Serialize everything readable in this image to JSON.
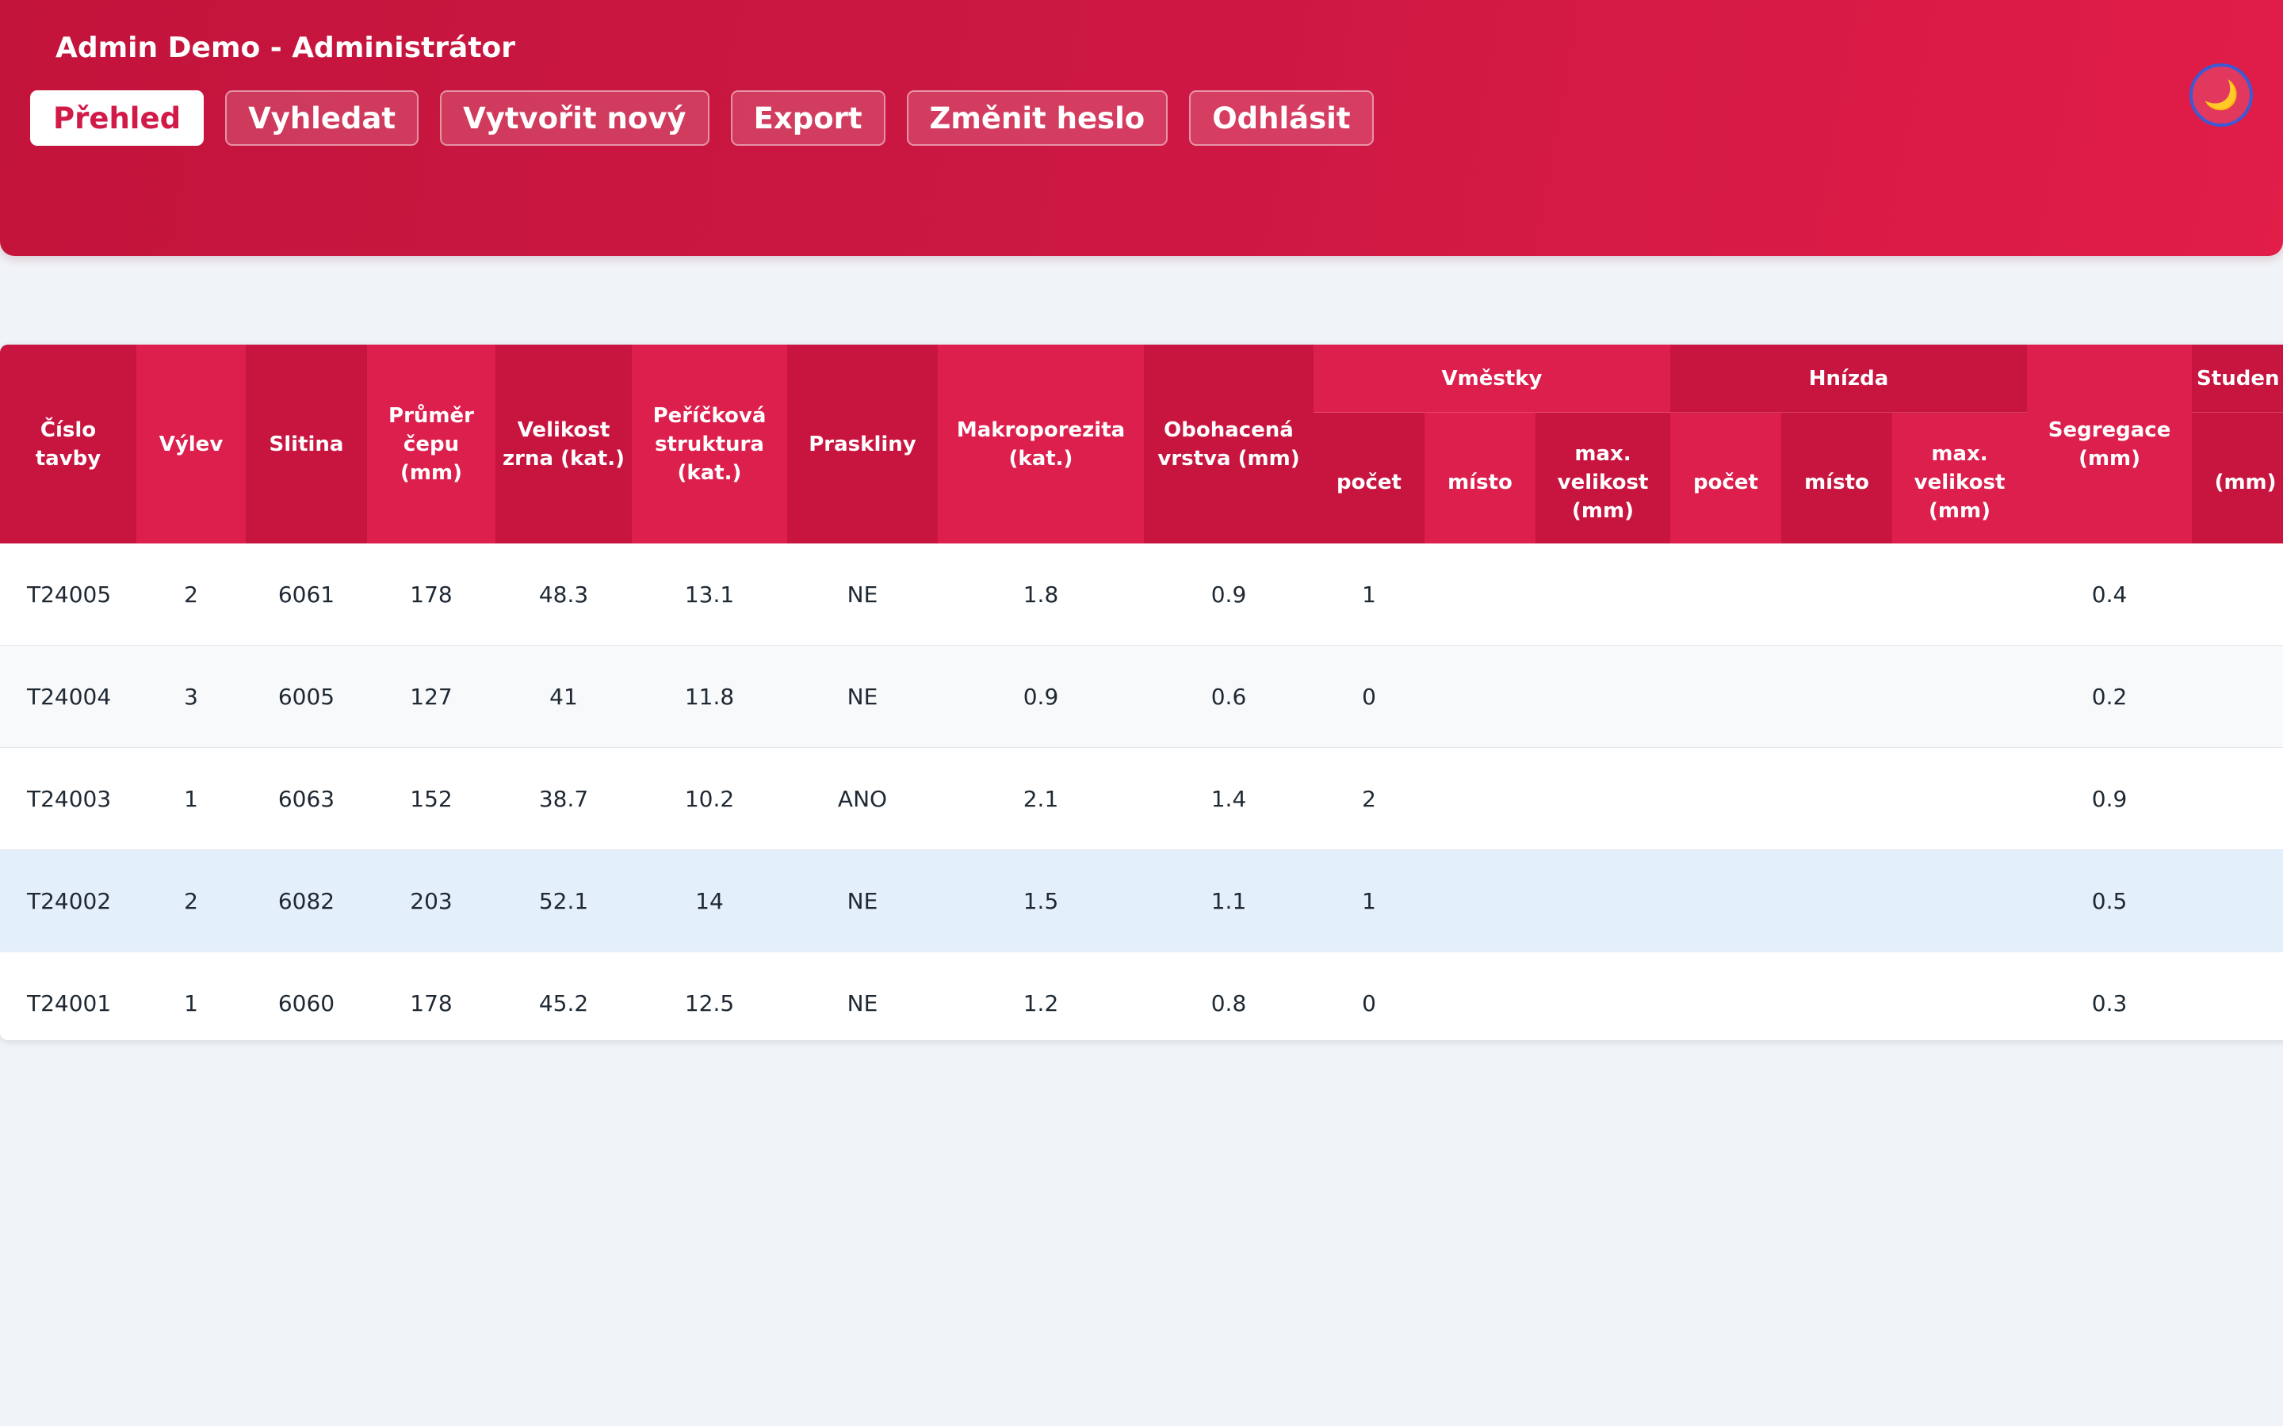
{
  "header": {
    "user_title": "Admin Demo - Administrátor",
    "nav": [
      {
        "label": "Přehled",
        "active": true
      },
      {
        "label": "Vyhledat",
        "active": false
      },
      {
        "label": "Vytvořit nový",
        "active": false
      },
      {
        "label": "Export",
        "active": false
      },
      {
        "label": "Změnit heslo",
        "active": false
      },
      {
        "label": "Odhlásit",
        "active": false
      }
    ],
    "theme_toggle_icon": "🌙"
  },
  "colors": {
    "accent": "#d11a47",
    "header_gradient_start": "#c3143c",
    "header_gradient_end": "#e11d48",
    "row_highlight": "#e3f0fb"
  },
  "table": {
    "columns": {
      "cislo_tavby": "Číslo tavby",
      "vylev": "Výlev",
      "slitina": "Slitina",
      "prumer_cepu": "Průměr čepu (mm)",
      "velikost_zrna": "Velikost zrna (kat.)",
      "perickova_struktura": "Peříčková struktura (kat.)",
      "praskliny": "Praskliny",
      "makroporezita": "Makroporezita (kat.)",
      "obohacena_vrstva": "Obohacená vrstva (mm)",
      "vmestky": "Vměstky",
      "hnizda": "Hnízda",
      "segregace": "Segregace (mm)",
      "studene": "Studen",
      "pocet": "počet",
      "misto": "místo",
      "max_velikost": "max. velikost (mm)",
      "mm": "(mm)"
    },
    "rows": [
      {
        "tavba": "T24005",
        "vylev": "2",
        "slitina": "6061",
        "prumer": "178",
        "zrno": "48.3",
        "perickova": "13.1",
        "praskliny": "NE",
        "makro": "1.8",
        "obohacena": "0.9",
        "vm_pocet": "1",
        "vm_misto": "",
        "vm_max": "",
        "hn_pocet": "",
        "hn_misto": "",
        "hn_max": "",
        "segregace": "0.4",
        "studene": ""
      },
      {
        "tavba": "T24004",
        "vylev": "3",
        "slitina": "6005",
        "prumer": "127",
        "zrno": "41",
        "perickova": "11.8",
        "praskliny": "NE",
        "makro": "0.9",
        "obohacena": "0.6",
        "vm_pocet": "0",
        "vm_misto": "",
        "vm_max": "",
        "hn_pocet": "",
        "hn_misto": "",
        "hn_max": "",
        "segregace": "0.2",
        "studene": ""
      },
      {
        "tavba": "T24003",
        "vylev": "1",
        "slitina": "6063",
        "prumer": "152",
        "zrno": "38.7",
        "perickova": "10.2",
        "praskliny": "ANO",
        "makro": "2.1",
        "obohacena": "1.4",
        "vm_pocet": "2",
        "vm_misto": "",
        "vm_max": "",
        "hn_pocet": "",
        "hn_misto": "",
        "hn_max": "",
        "segregace": "0.9",
        "studene": ""
      },
      {
        "tavba": "T24002",
        "vylev": "2",
        "slitina": "6082",
        "prumer": "203",
        "zrno": "52.1",
        "perickova": "14",
        "praskliny": "NE",
        "makro": "1.5",
        "obohacena": "1.1",
        "vm_pocet": "1",
        "vm_misto": "",
        "vm_max": "",
        "hn_pocet": "",
        "hn_misto": "",
        "hn_max": "",
        "segregace": "0.5",
        "studene": ""
      },
      {
        "tavba": "T24001",
        "vylev": "1",
        "slitina": "6060",
        "prumer": "178",
        "zrno": "45.2",
        "perickova": "12.5",
        "praskliny": "NE",
        "makro": "1.2",
        "obohacena": "0.8",
        "vm_pocet": "0",
        "vm_misto": "",
        "vm_max": "",
        "hn_pocet": "",
        "hn_misto": "",
        "hn_max": "",
        "segregace": "0.3",
        "studene": ""
      }
    ]
  }
}
